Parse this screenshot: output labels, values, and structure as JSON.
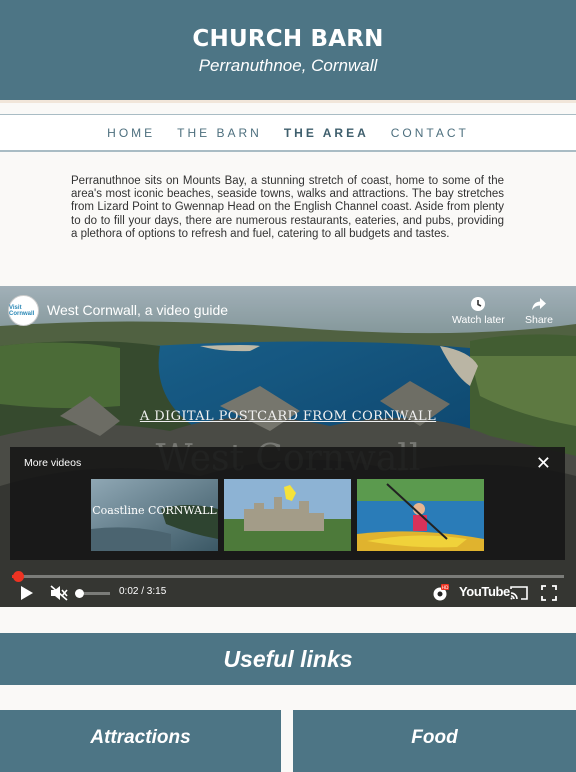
{
  "header": {
    "title": "CHURCH BARN",
    "subtitle": "Perranuthnoe, Cornwall"
  },
  "nav": {
    "items": [
      "HOME",
      "THE BARN",
      "THE AREA",
      "CONTACT"
    ],
    "active": "THE AREA"
  },
  "intro": "Perranuthnoe sits on Mounts Bay, a stunning stretch of coast, home to some of the area's most iconic beaches, seaside towns, walks and attractions. The bay stretches from Lizard Point to Gwennap Head on the English Channel coast. Aside from plenty to do to fill your days, there are numerous restaurants, eateries, and pubs, providing a plethora of options to refresh and fuel, catering to all budgets and tastes.",
  "video": {
    "title": "West Cornwall, a video guide",
    "channel_logo_text": "Visit Cornwall",
    "watch_later": "Watch later",
    "share": "Share",
    "overlay_text": "A DIGITAL POSTCARD FROM CORNWALL",
    "overlay_big": "West Cornwall",
    "more_videos_label": "More videos",
    "thumbnail_caption": "Coastline CORNWALL",
    "time": "0:02 / 3:15",
    "progress": 0.01,
    "youtube_label": "YouTube"
  },
  "useful_links": {
    "heading": "Useful links",
    "boxes": [
      "Attractions",
      "Food"
    ]
  },
  "colors": {
    "primary": "#4d7585",
    "accent": "#e32222"
  }
}
